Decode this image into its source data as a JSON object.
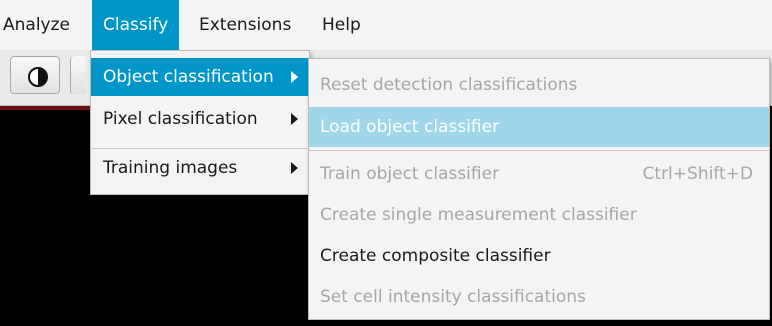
{
  "menubar": {
    "items": [
      {
        "label": "Analyze"
      },
      {
        "label": "Classify"
      },
      {
        "label": "Extensions"
      },
      {
        "label": "Help"
      }
    ]
  },
  "toolbar": {
    "partial_label": "1"
  },
  "classify_menu": {
    "items": [
      {
        "label": "Object classification"
      },
      {
        "label": "Pixel classification"
      },
      {
        "label": "Training images"
      }
    ]
  },
  "object_classification_submenu": {
    "items": [
      {
        "label": "Reset detection classifications",
        "enabled": false
      },
      {
        "label": "Load object classifier",
        "enabled": true
      },
      {
        "label": "Train object classifier",
        "shortcut": "Ctrl+Shift+D",
        "enabled": false
      },
      {
        "label": "Create single measurement classifier",
        "enabled": false
      },
      {
        "label": "Create composite classifier",
        "enabled": true
      },
      {
        "label": "Set cell intensity classifications",
        "enabled": false
      }
    ]
  },
  "colors": {
    "accent": "#0096c9",
    "hover": "#9fd6ea",
    "disabled_text": "#a6a6a6"
  }
}
